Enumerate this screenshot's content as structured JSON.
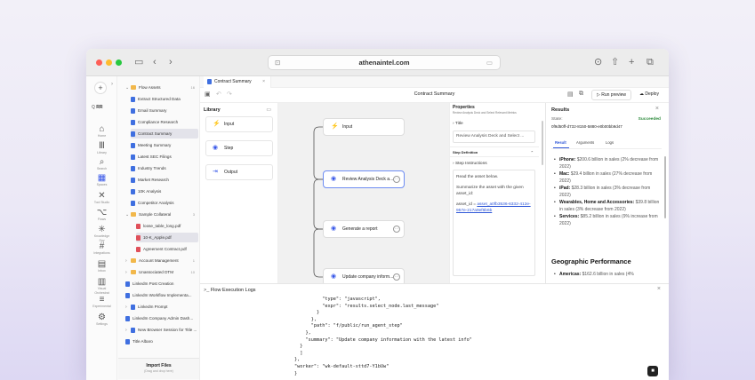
{
  "browser": {
    "url": "athenaintel.com"
  },
  "rail": {
    "items": [
      {
        "icon": "home-icon",
        "glyph": "⌂",
        "label": "Home"
      },
      {
        "icon": "library-icon",
        "glyph": "Ⅲ",
        "label": "Library"
      },
      {
        "icon": "search-icon",
        "glyph": "⌕",
        "label": "Search"
      },
      {
        "icon": "spaces-icon",
        "glyph": "▦",
        "label": "Spaces"
      },
      {
        "icon": "tools-icon",
        "glyph": "✕",
        "label": "Tool Studio"
      },
      {
        "icon": "flows-icon",
        "glyph": "⌥",
        "label": "Flows"
      },
      {
        "icon": "workflow-icon",
        "glyph": "✳",
        "label": "Knowledge Spy"
      },
      {
        "icon": "integrations-icon",
        "glyph": "#",
        "label": "Integrations"
      },
      {
        "icon": "inbox-icon",
        "glyph": "▤",
        "label": "Inbox"
      },
      {
        "icon": "visual-icon",
        "glyph": "▥",
        "label": "Visual Orchestrat"
      },
      {
        "icon": "experimental-icon",
        "glyph": "≡",
        "label": "Experimental"
      },
      {
        "icon": "settings-icon",
        "glyph": "⚙",
        "label": "Settings"
      }
    ],
    "user_initials": "RR"
  },
  "tree": {
    "root": {
      "label": "Flow Assets",
      "count": "16"
    },
    "items": [
      {
        "label": "Extract Structured Data",
        "type": "doc"
      },
      {
        "label": "Email Summary",
        "type": "doc"
      },
      {
        "label": "Compliance Research",
        "type": "doc"
      },
      {
        "label": "Contract Summary",
        "type": "doc",
        "selected": true
      },
      {
        "label": "Meeting Summary",
        "type": "doc"
      },
      {
        "label": "Latest SEC Filings",
        "type": "doc"
      },
      {
        "label": "Industry Trends",
        "type": "doc"
      },
      {
        "label": "Market Research",
        "type": "doc"
      },
      {
        "label": "10K Analysis",
        "type": "doc"
      },
      {
        "label": "Competitor Analysis",
        "type": "doc"
      }
    ],
    "subfolder": {
      "label": "Sample Collateral",
      "count": "3"
    },
    "subitems": [
      {
        "label": "loose_table_long.pdf",
        "type": "pdf"
      },
      {
        "label": "10-K_Apple.pdf",
        "type": "pdf",
        "selected": true
      },
      {
        "label": "Agreement Contract.pdf",
        "type": "pdf"
      }
    ],
    "folders": [
      {
        "label": "Account Management",
        "count": "1"
      },
      {
        "label": "Unassociated DTM",
        "count": "10"
      }
    ],
    "bottom_items": [
      {
        "label": "LinkedIn Post Creation",
        "chev": false
      },
      {
        "label": "LinkedIn Workflow Implementa...",
        "chev": false
      },
      {
        "label": "LinkedIn Prompt",
        "chev": true
      },
      {
        "label": "LinkedIn Company Admin Dash...",
        "chev": false
      },
      {
        "label": "New Browser Session for Title ...",
        "chev": true
      },
      {
        "label": "Title Albaro",
        "chev": false
      }
    ],
    "import": {
      "title": "Import Files",
      "subtitle": "(Drag and drop here)"
    }
  },
  "tab": {
    "label": "Contract Summary"
  },
  "toolbar": {
    "title": "Contract Summary",
    "run_label": "Run preview",
    "deploy_label": "Deploy"
  },
  "library": {
    "title": "Library",
    "items": [
      {
        "icon": "input-icon",
        "glyph": "⚡",
        "label": "Input"
      },
      {
        "icon": "step-icon",
        "glyph": "◉",
        "label": "Step"
      },
      {
        "icon": "output-icon",
        "glyph": "⇥",
        "label": "Output"
      }
    ]
  },
  "canvas": {
    "nodes": [
      {
        "label": "Input",
        "glyph": "⚡"
      },
      {
        "label": "Review Analysis Deck a...",
        "glyph": "◉"
      },
      {
        "label": "Generate a report",
        "glyph": "◉"
      },
      {
        "label": "Update company inform...",
        "glyph": "◉"
      }
    ]
  },
  "properties": {
    "title": "Properties",
    "subtitle": "Review Analysis Deck and Select Relevant Metrics",
    "title_section": "Title",
    "title_value": "Review Analysis Deck and Select ...",
    "step_definition": "Step Definition",
    "step_instructions": "Step Instructions",
    "instr_1": "Read the asset below.",
    "instr_2": "Summarize the asset with the given asset_id:",
    "asset_prefix": "asset_id =",
    "asset_link": "asset_a0fb3536-6332-412e-957e-217a9ef6b6b"
  },
  "results": {
    "title": "Results",
    "state_label": "State:",
    "state_value": "Succeeded",
    "id": "0f9d50ff-d732-8150-5880-e0b00bb9d47",
    "tabs": [
      "Result",
      "Arguments",
      "Logs"
    ],
    "bullets": [
      {
        "bold": "iPhone:",
        "text": " $200.6 billion in sales (2% decrease from 2022)"
      },
      {
        "bold": "Mac:",
        "text": " $29.4 billion in sales (27% decrease from 2022)"
      },
      {
        "bold": "iPad:",
        "text": " $28.3 billion in sales (3% decrease from 2022)"
      },
      {
        "bold": "Wearables, Home and Accessories:",
        "text": " $39.8 billion in sales (3% decrease from 2022)"
      },
      {
        "bold": "Services:",
        "text": " $85.2 billion in sales (9% increase from 2022)"
      }
    ],
    "section_heading": "Geographic Performance",
    "geo_bullet": {
      "bold": "Americas:",
      "text": " $162.6 billion in sales (4%"
    }
  },
  "logs": {
    "title": "Flow Execution Logs",
    "lines": [
      "          \"type\": \"javascript\",",
      "          \"expr\": \"results.select_node.last_message\"",
      "        }",
      "      },",
      "      \"path\": \"f/public/run_agent_step\"",
      "    },",
      "    \"summary\": \"Update company information with the latest info\"",
      "  }",
      "  ]",
      "},",
      "\"worker\": \"wk-default-sttd7-Y1bUw\"",
      "}"
    ]
  }
}
